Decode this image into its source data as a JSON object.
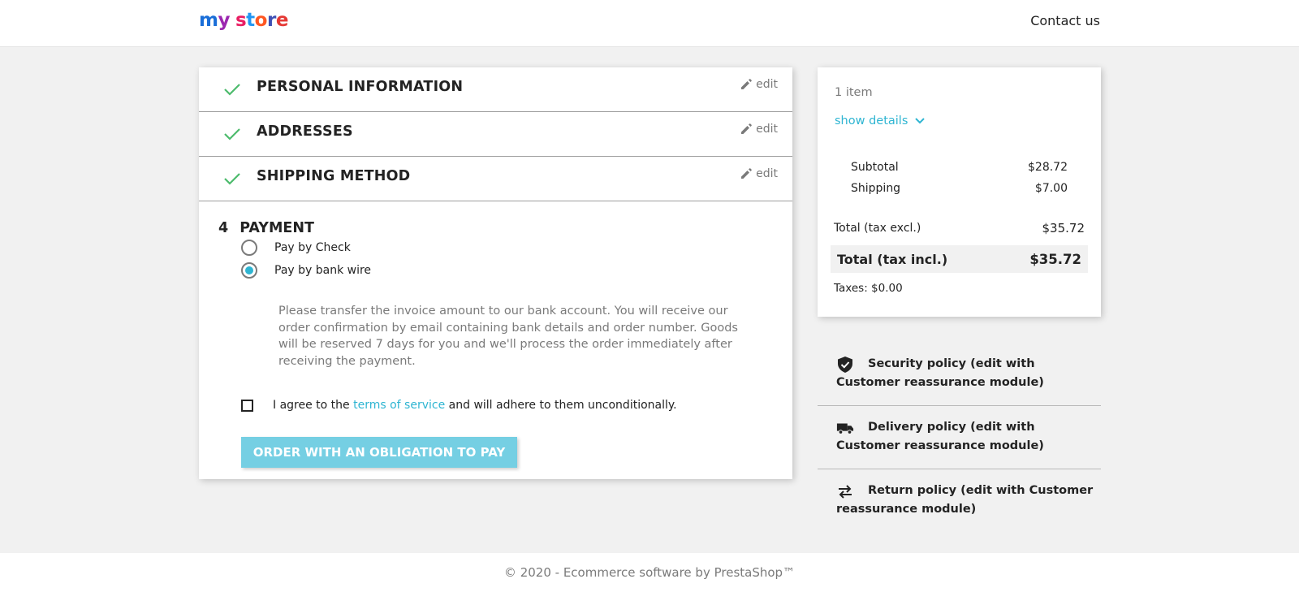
{
  "header": {
    "logo_text": "my store",
    "contact_label": "Contact us"
  },
  "checkout": {
    "completed_steps": [
      {
        "title": "PERSONAL INFORMATION",
        "edit_label": "edit"
      },
      {
        "title": "ADDRESSES",
        "edit_label": "edit"
      },
      {
        "title": "SHIPPING METHOD",
        "edit_label": "edit"
      }
    ],
    "payment": {
      "number": "4",
      "title": "PAYMENT",
      "options": [
        {
          "label": "Pay by Check",
          "selected": false
        },
        {
          "label": "Pay by bank wire",
          "selected": true
        }
      ],
      "description": "Please transfer the invoice amount to our bank account. You will receive our order confirmation by email containing bank details and order number. Goods will be reserved 7 days for you and we'll process the order immediately after receiving the payment.",
      "agree_prefix": "I agree to the",
      "agree_link": "terms of service",
      "agree_suffix": "and will adhere to them unconditionally.",
      "agree_checked": false,
      "order_button": "ORDER WITH AN OBLIGATION TO PAY"
    }
  },
  "summary": {
    "items_count": "1 item",
    "show_details": "show details",
    "subtotal_label": "Subtotal",
    "subtotal_value": "$28.72",
    "shipping_label": "Shipping",
    "shipping_value": "$7.00",
    "total_excl_label": "Total (tax excl.)",
    "total_excl_value": "$35.72",
    "total_incl_label": "Total (tax incl.)",
    "total_incl_value": "$35.72",
    "taxes_label": "Taxes: $0.00"
  },
  "reassurance": [
    {
      "icon": "shield-check-icon",
      "text": "Security policy (edit with Customer reassurance module)"
    },
    {
      "icon": "truck-icon",
      "text": "Delivery policy (edit with Customer reassurance module)"
    },
    {
      "icon": "swap-arrows-icon",
      "text": "Return policy (edit with Customer reassurance module)"
    }
  ],
  "footer": {
    "copyright": "© 2020 - Ecommerce software by PrestaShop™"
  },
  "colors": {
    "accent": "#2fb5d2",
    "button_disabled": "#75cfe3",
    "check_green": "#4cbb6c",
    "background": "#f1f1f1"
  }
}
